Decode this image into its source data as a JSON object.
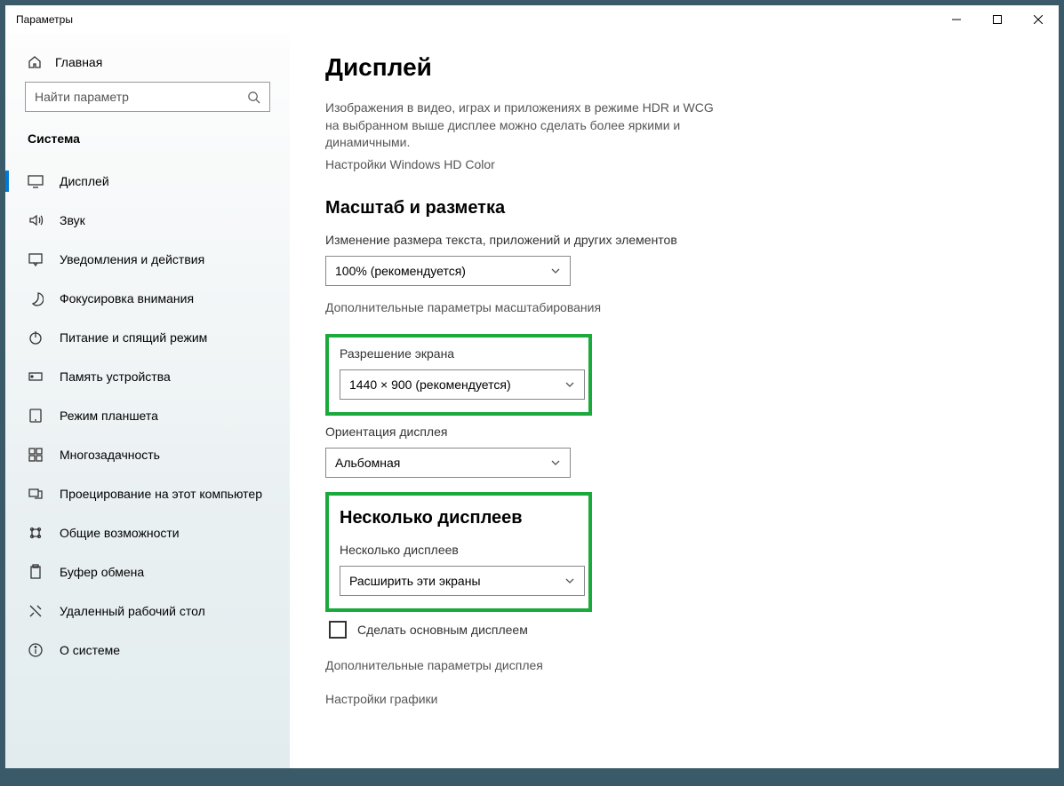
{
  "titlebar": {
    "title": "Параметры"
  },
  "sidebar": {
    "home": "Главная",
    "search_placeholder": "Найти параметр",
    "category": "Система",
    "items": [
      {
        "label": "Дисплей",
        "icon": "display"
      },
      {
        "label": "Звук",
        "icon": "sound"
      },
      {
        "label": "Уведомления и действия",
        "icon": "notify"
      },
      {
        "label": "Фокусировка внимания",
        "icon": "focus"
      },
      {
        "label": "Питание и спящий режим",
        "icon": "power"
      },
      {
        "label": "Память устройства",
        "icon": "storage"
      },
      {
        "label": "Режим планшета",
        "icon": "tablet"
      },
      {
        "label": "Многозадачность",
        "icon": "multi"
      },
      {
        "label": "Проецирование на этот компьютер",
        "icon": "project"
      },
      {
        "label": "Общие возможности",
        "icon": "share"
      },
      {
        "label": "Буфер обмена",
        "icon": "clip"
      },
      {
        "label": "Удаленный рабочий стол",
        "icon": "remote"
      },
      {
        "label": "О системе",
        "icon": "about"
      }
    ]
  },
  "main": {
    "page_title": "Дисплей",
    "hdr_desc": "Изображения в видео, играх и приложениях в режиме HDR и WCG на выбранном выше дисплее можно сделать более яркими и динамичными.",
    "hdr_link": "Настройки Windows HD Color",
    "scale_heading": "Масштаб и разметка",
    "scale_label": "Изменение размера текста, приложений и других элементов",
    "scale_value": "100% (рекомендуется)",
    "scale_link": "Дополнительные параметры масштабирования",
    "res_label": "Разрешение экрана",
    "res_value": "1440 × 900 (рекомендуется)",
    "orient_label": "Ориентация дисплея",
    "orient_value": "Альбомная",
    "multi_heading": "Несколько дисплеев",
    "multi_label": "Несколько дисплеев",
    "multi_value": "Расширить эти экраны",
    "primary_check": "Сделать основным дисплеем",
    "adv_link": "Дополнительные параметры дисплея",
    "gfx_link": "Настройки графики"
  }
}
